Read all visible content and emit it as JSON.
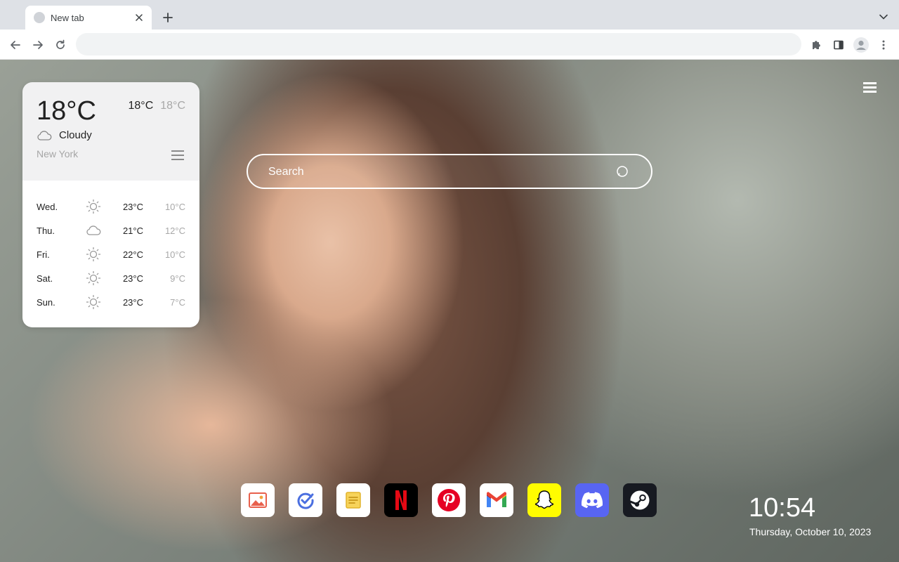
{
  "browser": {
    "tab": {
      "title": "New tab"
    },
    "omnibox": {
      "value": "",
      "placeholder": ""
    }
  },
  "weather": {
    "current_temp": "18°C",
    "high": "18°C",
    "low": "18°C",
    "condition": "Cloudy",
    "condition_icon": "cloud-icon",
    "city": "New York",
    "forecast": [
      {
        "day": "Wed.",
        "icon": "sun-icon",
        "high": "23°C",
        "low": "10°C"
      },
      {
        "day": "Thu.",
        "icon": "cloud-icon",
        "high": "21°C",
        "low": "12°C"
      },
      {
        "day": "Fri.",
        "icon": "sun-icon",
        "high": "22°C",
        "low": "10°C"
      },
      {
        "day": "Sat.",
        "icon": "sun-icon",
        "high": "23°C",
        "low": "9°C"
      },
      {
        "day": "Sun.",
        "icon": "sun-icon",
        "high": "23°C",
        "low": "7°C"
      }
    ]
  },
  "search": {
    "placeholder": "Search"
  },
  "dock": {
    "apps": [
      {
        "id": "photos",
        "icon": "image-gallery-icon",
        "bg": "#ffffff"
      },
      {
        "id": "tasks",
        "icon": "checkmark-circle-icon",
        "bg": "#ffffff"
      },
      {
        "id": "notes",
        "icon": "notes-icon",
        "bg": "#ffffff"
      },
      {
        "id": "netflix",
        "icon": "netflix-icon",
        "bg": "#000000"
      },
      {
        "id": "pinterest",
        "icon": "pinterest-icon",
        "bg": "#ffffff"
      },
      {
        "id": "gmail",
        "icon": "gmail-icon",
        "bg": "#ffffff"
      },
      {
        "id": "snapchat",
        "icon": "snapchat-icon",
        "bg": "#fffc00"
      },
      {
        "id": "discord",
        "icon": "discord-icon",
        "bg": "#5865f2"
      },
      {
        "id": "steam",
        "icon": "steam-icon",
        "bg": "#171a21"
      }
    ]
  },
  "clock": {
    "time": "10:54",
    "date": "Thursday, October 10, 2023"
  }
}
